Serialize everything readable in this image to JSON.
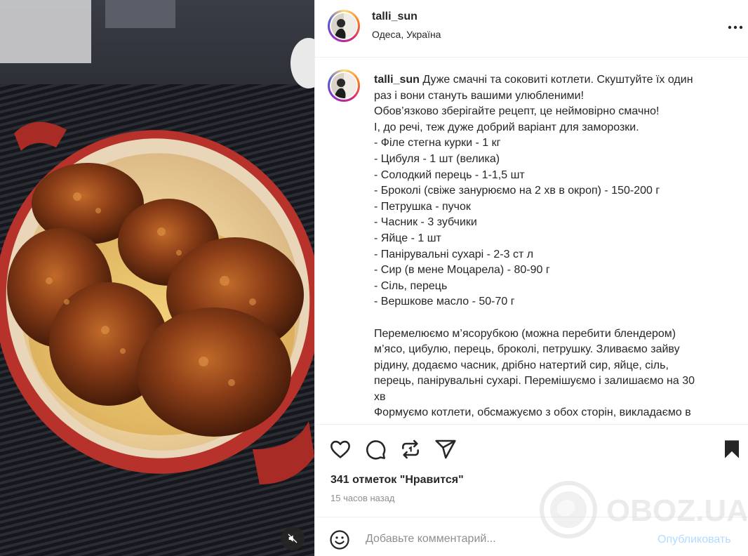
{
  "post": {
    "username": "talli_sun",
    "location": "Одеса, Україна",
    "more_icon": "more-horizontal-icon"
  },
  "caption": {
    "username": "talli_sun",
    "lines": [
      "Дуже смачні та соковиті котлети. Скуштуйте їх один",
      "раз і вони стануть вашими улюбленими!",
      "Обов’язково зберігайте рецепт, це неймовірно смачно!",
      "І, до речі, теж дуже добрий варіант для заморозки.",
      "- Філе стегна курки - 1 кг",
      "- Цибуля - 1 шт (велика)",
      "- Солодкий перець - 1-1,5 шт",
      "- Броколі (свіже занурюємо на 2 хв в окроп) - 150-200 г",
      "- Петрушка - пучок",
      "- Часник - 3 зубчики",
      "- Яйце - 1 шт",
      "- Панірувальні сухарі - 2-3 ст л",
      "- Сир (в мене Моцарела) - 80-90 г",
      "- Сіль, перець",
      "- Вершкове масло - 50-70 г",
      "",
      "Перемелюємо м’ясорубкою (можна перебити блендером)",
      "м’ясо, цибулю, перець, броколі, петрушку. Зливаємо зайву",
      "рідину, додаємо часник, дрібно натертий сир, яйце, сіль,",
      "перець, панірувальні сухарі. Перемішуємо і залишаємо на 30",
      "хв",
      "Формуємо котлети, обсмажуємо з обох сторін, викладаємо в"
    ]
  },
  "actions": {
    "like_icon": "heart-icon",
    "comment_icon": "comment-icon",
    "repost_icon": "repost-icon",
    "share_icon": "share-icon",
    "save_icon": "bookmark-filled-icon"
  },
  "likes_text": "341 отметок \"Нравится\"",
  "time_ago": "15 часов назад",
  "comment": {
    "placeholder": "Добавьте комментарий...",
    "value": "",
    "publish_label": "Опубликовать",
    "emoji_icon": "emoji-icon"
  },
  "media": {
    "description_icon": "mute-icon"
  },
  "watermark": {
    "text": "OBOZ.UA"
  },
  "colors": {
    "text": "#262626",
    "secondary": "#8e8e8e",
    "publish_disabled": "#b3dbff",
    "border": "#efefef",
    "dish_red": "#b8322c"
  }
}
